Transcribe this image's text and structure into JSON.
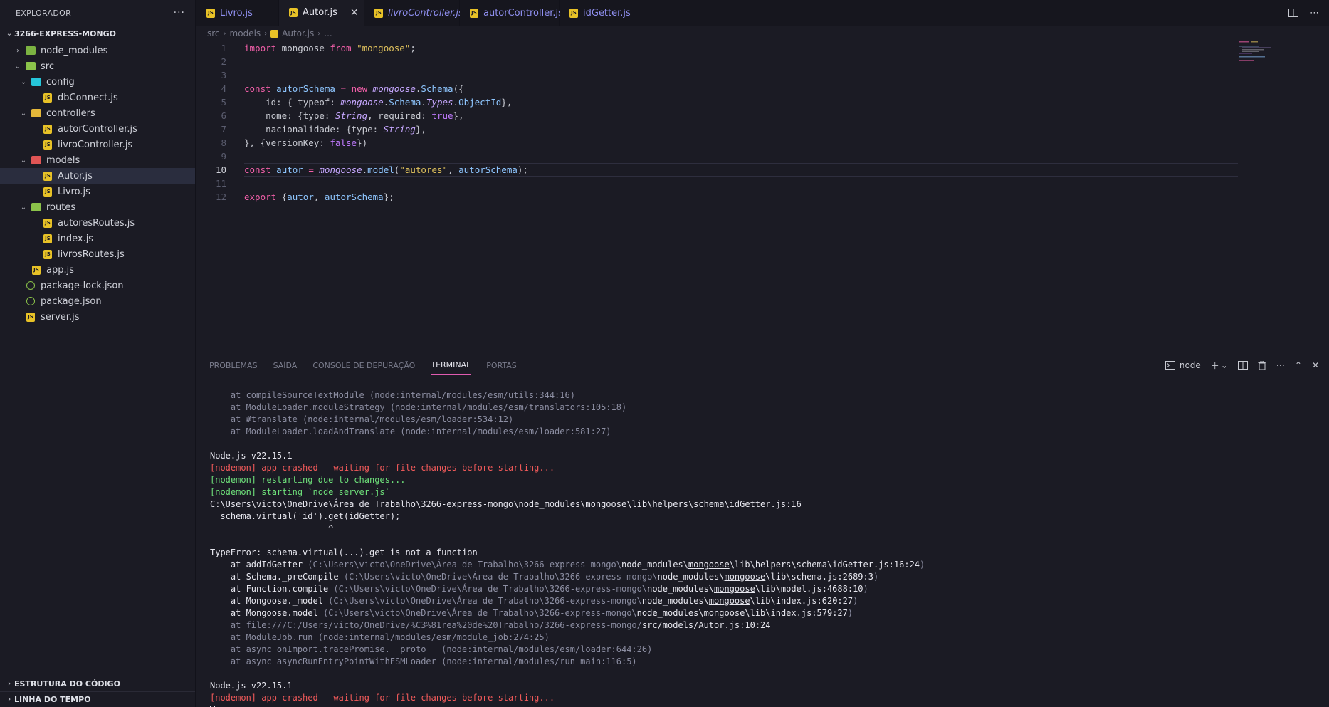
{
  "sidebar": {
    "title": "EXPLORADOR",
    "more": "···",
    "project": "3266-EXPRESS-MONGO",
    "tree": [
      {
        "label": "node_modules"
      },
      {
        "label": "src"
      },
      {
        "label": "config"
      },
      {
        "label": "dbConnect.js"
      },
      {
        "label": "controllers"
      },
      {
        "label": "autorController.js"
      },
      {
        "label": "livroController.js"
      },
      {
        "label": "models"
      },
      {
        "label": "Autor.js"
      },
      {
        "label": "Livro.js"
      },
      {
        "label": "routes"
      },
      {
        "label": "autoresRoutes.js"
      },
      {
        "label": "index.js"
      },
      {
        "label": "livrosRoutes.js"
      },
      {
        "label": "app.js"
      },
      {
        "label": "package-lock.json"
      },
      {
        "label": "package.json"
      },
      {
        "label": "server.js"
      }
    ],
    "sections": [
      "ESTRUTURA DO CÓDIGO",
      "LINHA DO TEMPO"
    ]
  },
  "tabs": [
    {
      "label": "Livro.js"
    },
    {
      "label": "Autor.js",
      "close": "✕"
    },
    {
      "label": "livroController.js"
    },
    {
      "label": "autorController.js"
    },
    {
      "label": "idGetter.js"
    }
  ],
  "breadcrumb": [
    "src",
    "models",
    "Autor.js",
    "..."
  ],
  "editor": {
    "line_numbers": [
      "1",
      "2",
      "3",
      "4",
      "5",
      "6",
      "7",
      "8",
      "9",
      "10",
      "11",
      "12"
    ]
  },
  "panel": {
    "tabs": [
      "PROBLEMAS",
      "SAÍDA",
      "CONSOLE DE DEPURAÇÃO",
      "TERMINAL",
      "PORTAS"
    ],
    "shell": "node",
    "terminal": {
      "l1": "    at compileSourceTextModule (node:internal/modules/esm/utils:344:16)",
      "l2": "    at ModuleLoader.moduleStrategy (node:internal/modules/esm/translators:105:18)",
      "l3": "    at #translate (node:internal/modules/esm/loader:534:12)",
      "l4": "    at ModuleLoader.loadAndTranslate (node:internal/modules/esm/loader:581:27)",
      "l5": "Node.js v22.15.1",
      "l6": "[nodemon] app crashed - waiting for file changes before starting...",
      "l7": "[nodemon] restarting due to changes...",
      "l8": "[nodemon] starting `node server.js`",
      "l9": "C:\\Users\\victo\\OneDrive\\Área de Trabalho\\3266-express-mongo\\node_modules\\mongoose\\lib\\helpers\\schema\\idGetter.js:16",
      "l10": "  schema.virtual('id').get(idGetter);",
      "l11": "                       ^",
      "l12": "TypeError: schema.virtual(...).get is not a function",
      "s1a": "    at addIdGetter ",
      "s1b": "(C:\\Users\\victo\\OneDrive\\Área de Trabalho\\3266-express-mongo\\",
      "s1c": "node_modules\\",
      "s1d": "mongoose",
      "s1e": "\\lib\\helpers\\schema\\idGetter.js:16:24",
      "s1f": ")",
      "s2a": "    at Schema._preCompile ",
      "s2b": "(C:\\Users\\victo\\OneDrive\\Área de Trabalho\\3266-express-mongo\\",
      "s2c": "node_modules\\",
      "s2d": "mongoose",
      "s2e": "\\lib\\schema.js:2689:3",
      "s2f": ")",
      "s3a": "    at Function.compile ",
      "s3b": "(C:\\Users\\victo\\OneDrive\\Área de Trabalho\\3266-express-mongo\\",
      "s3c": "node_modules\\",
      "s3d": "mongoose",
      "s3e": "\\lib\\model.js:4688:10",
      "s3f": ")",
      "s4a": "    at Mongoose._model ",
      "s4b": "(C:\\Users\\victo\\OneDrive\\Área de Trabalho\\3266-express-mongo\\",
      "s4c": "node_modules\\",
      "s4d": "mongoose",
      "s4e": "\\lib\\index.js:620:27",
      "s4f": ")",
      "s5a": "    at Mongoose.model ",
      "s5b": "(C:\\Users\\victo\\OneDrive\\Área de Trabalho\\3266-express-mongo\\",
      "s5c": "node_modules\\",
      "s5d": "mongoose",
      "s5e": "\\lib\\index.js:579:27",
      "s5f": ")",
      "s6a": "    at file:///C:/Users/victo/OneDrive/%C3%81rea%20de%20Trabalho/3266-express-mongo/",
      "s6b": "src/models/Autor.js:10:24",
      "l13": "    at ModuleJob.run (node:internal/modules/esm/module_job:274:25)",
      "l14": "    at async onImport.tracePromise.__proto__ (node:internal/modules/esm/loader:644:26)",
      "l15": "    at async asyncRunEntryPointWithESMLoader (node:internal/modules/run_main:116:5)",
      "l16": "Node.js v22.15.1",
      "l17": "[nodemon] app crashed - waiting for file changes before starting..."
    }
  },
  "colors": {
    "background": "#1b1b24",
    "accent": "#f25fa9",
    "error": "#f25a5a",
    "success": "#6ee07a"
  }
}
